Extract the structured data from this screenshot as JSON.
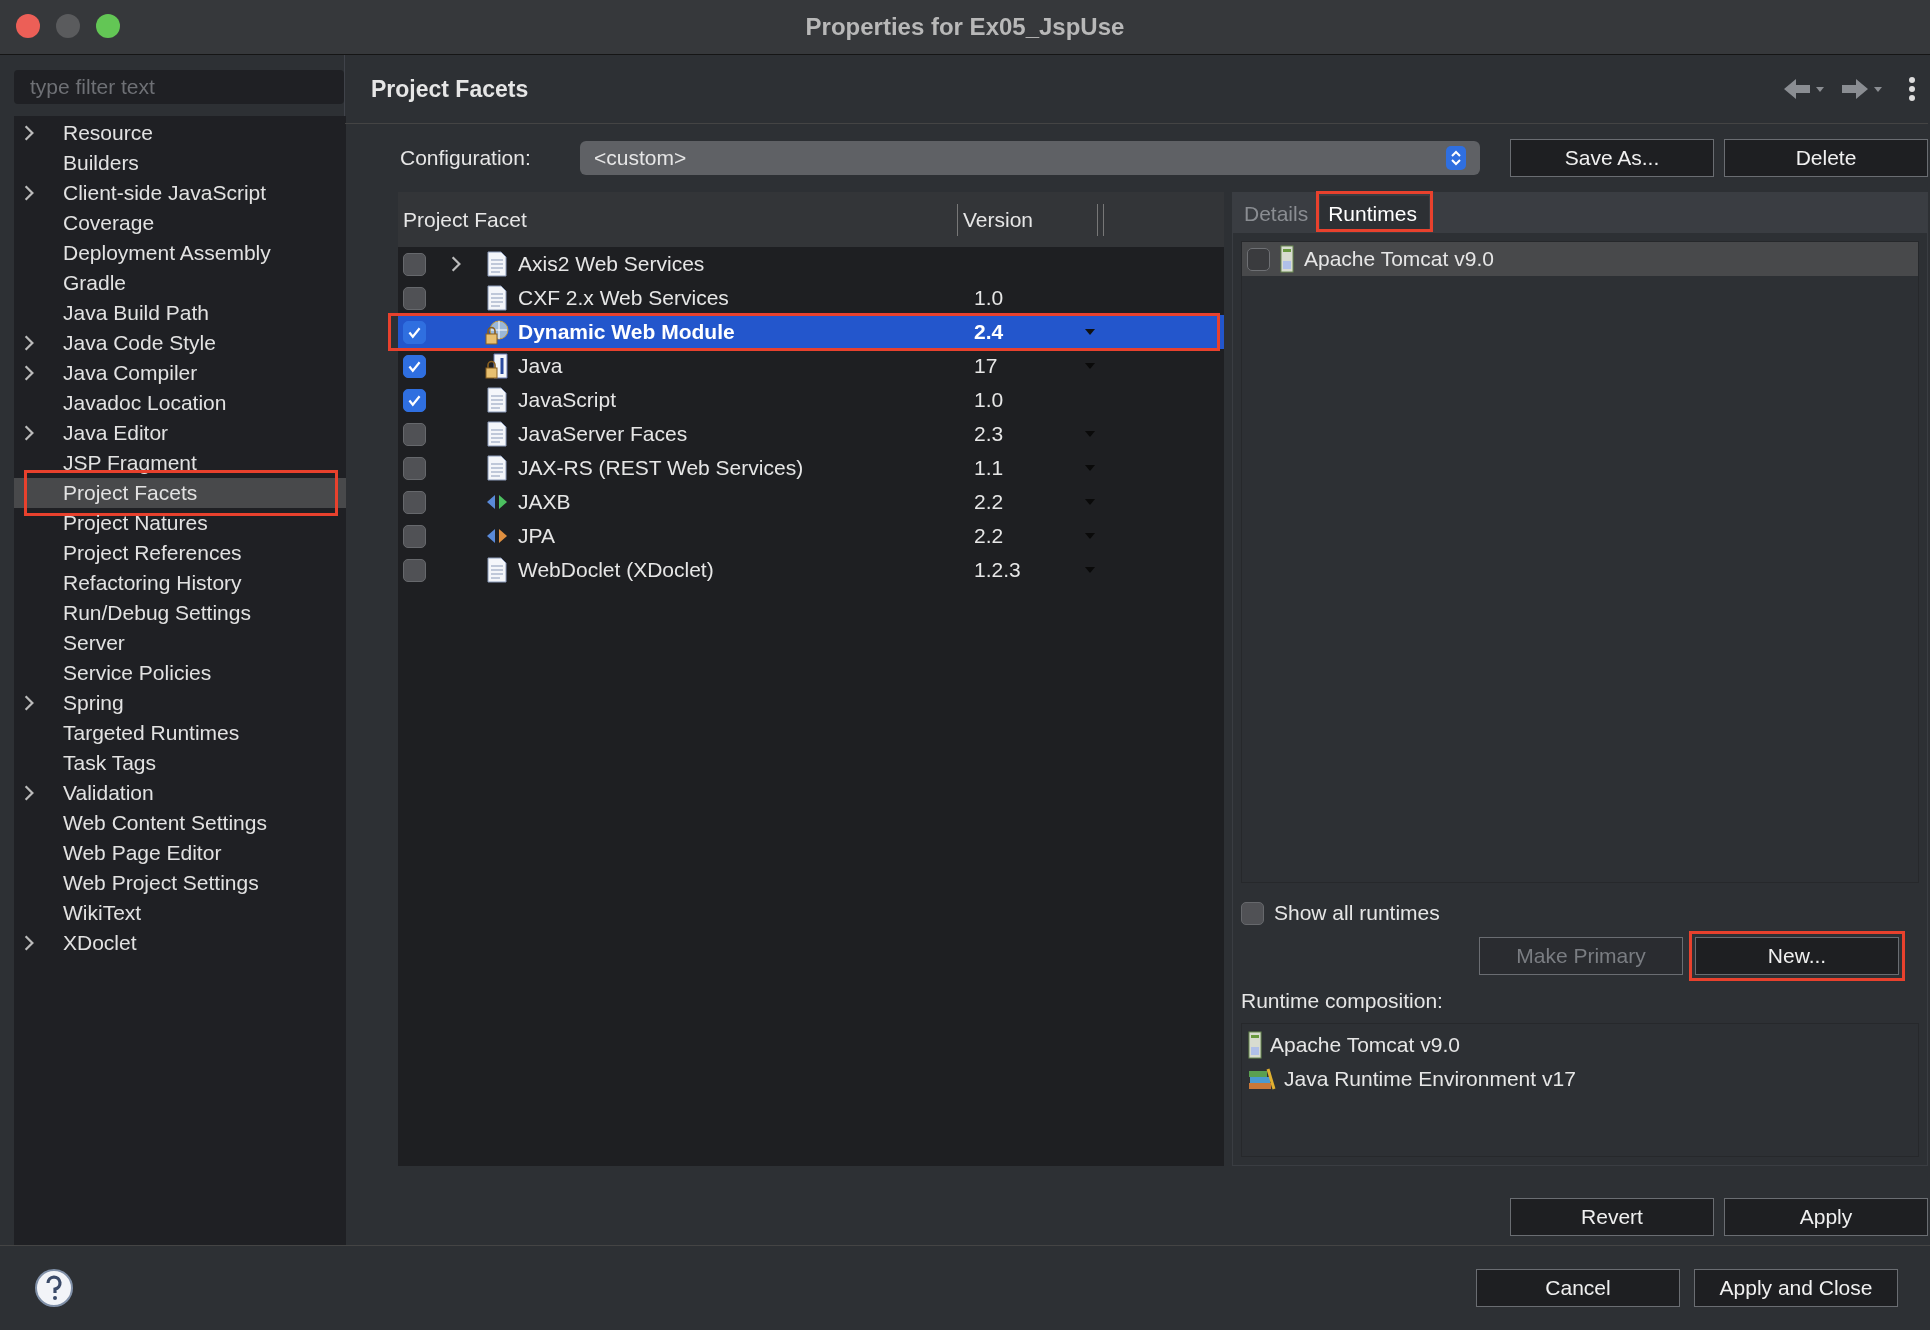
{
  "window": {
    "title": "Properties for Ex05_JspUse"
  },
  "filter": {
    "placeholder": "type filter text"
  },
  "sidebar": {
    "items": [
      {
        "label": "Resource",
        "expandable": true,
        "selected": false,
        "marked": false
      },
      {
        "label": "Builders",
        "expandable": false,
        "selected": false,
        "marked": false
      },
      {
        "label": "Client-side JavaScript",
        "expandable": true,
        "selected": false,
        "marked": false
      },
      {
        "label": "Coverage",
        "expandable": false,
        "selected": false,
        "marked": false
      },
      {
        "label": "Deployment Assembly",
        "expandable": false,
        "selected": false,
        "marked": false
      },
      {
        "label": "Gradle",
        "expandable": false,
        "selected": false,
        "marked": false
      },
      {
        "label": "Java Build Path",
        "expandable": false,
        "selected": false,
        "marked": false
      },
      {
        "label": "Java Code Style",
        "expandable": true,
        "selected": false,
        "marked": false
      },
      {
        "label": "Java Compiler",
        "expandable": true,
        "selected": false,
        "marked": false
      },
      {
        "label": "Javadoc Location",
        "expandable": false,
        "selected": false,
        "marked": false
      },
      {
        "label": "Java Editor",
        "expandable": true,
        "selected": false,
        "marked": false
      },
      {
        "label": "JSP Fragment",
        "expandable": false,
        "selected": false,
        "marked": false
      },
      {
        "label": "Project Facets",
        "expandable": false,
        "selected": true,
        "marked": true
      },
      {
        "label": "Project Natures",
        "expandable": false,
        "selected": false,
        "marked": false
      },
      {
        "label": "Project References",
        "expandable": false,
        "selected": false,
        "marked": false
      },
      {
        "label": "Refactoring History",
        "expandable": false,
        "selected": false,
        "marked": false
      },
      {
        "label": "Run/Debug Settings",
        "expandable": false,
        "selected": false,
        "marked": false
      },
      {
        "label": "Server",
        "expandable": false,
        "selected": false,
        "marked": false
      },
      {
        "label": "Service Policies",
        "expandable": false,
        "selected": false,
        "marked": false
      },
      {
        "label": "Spring",
        "expandable": true,
        "selected": false,
        "marked": false
      },
      {
        "label": "Targeted Runtimes",
        "expandable": false,
        "selected": false,
        "marked": false
      },
      {
        "label": "Task Tags",
        "expandable": false,
        "selected": false,
        "marked": false
      },
      {
        "label": "Validation",
        "expandable": true,
        "selected": false,
        "marked": false
      },
      {
        "label": "Web Content Settings",
        "expandable": false,
        "selected": false,
        "marked": false
      },
      {
        "label": "Web Page Editor",
        "expandable": false,
        "selected": false,
        "marked": false
      },
      {
        "label": "Web Project Settings",
        "expandable": false,
        "selected": false,
        "marked": false
      },
      {
        "label": "WikiText",
        "expandable": false,
        "selected": false,
        "marked": false
      },
      {
        "label": "XDoclet",
        "expandable": true,
        "selected": false,
        "marked": false
      }
    ]
  },
  "page": {
    "title": "Project Facets"
  },
  "configuration": {
    "label": "Configuration:",
    "value": "<custom>",
    "buttons": [
      "Save As...",
      "Delete"
    ]
  },
  "facets": {
    "columns": [
      "Project Facet",
      "Version"
    ],
    "rows": [
      {
        "name": "Axis2 Web Services",
        "version": "",
        "kind": "document",
        "checked": false,
        "selected": false,
        "expandable": true,
        "dropdown": false,
        "marked": false
      },
      {
        "name": "CXF 2.x Web Services",
        "version": "1.0",
        "kind": "document",
        "checked": false,
        "selected": false,
        "expandable": false,
        "dropdown": false,
        "marked": false
      },
      {
        "name": "Dynamic Web Module",
        "version": "2.4",
        "kind": "web-module",
        "checked": true,
        "selected": true,
        "expandable": false,
        "dropdown": true,
        "marked": true
      },
      {
        "name": "Java",
        "version": "17",
        "kind": "java",
        "checked": true,
        "selected": false,
        "expandable": false,
        "dropdown": true,
        "marked": false
      },
      {
        "name": "JavaScript",
        "version": "1.0",
        "kind": "document",
        "checked": true,
        "selected": false,
        "expandable": false,
        "dropdown": false,
        "marked": false
      },
      {
        "name": "JavaServer Faces",
        "version": "2.3",
        "kind": "document",
        "checked": false,
        "selected": false,
        "expandable": false,
        "dropdown": true,
        "marked": false
      },
      {
        "name": "JAX-RS (REST Web Services)",
        "version": "1.1",
        "kind": "document",
        "checked": false,
        "selected": false,
        "expandable": false,
        "dropdown": true,
        "marked": false
      },
      {
        "name": "JAXB",
        "version": "2.2",
        "kind": "jaxb",
        "checked": false,
        "selected": false,
        "expandable": false,
        "dropdown": true,
        "marked": false
      },
      {
        "name": "JPA",
        "version": "2.2",
        "kind": "jpa",
        "checked": false,
        "selected": false,
        "expandable": false,
        "dropdown": true,
        "marked": false
      },
      {
        "name": "WebDoclet (XDoclet)",
        "version": "1.2.3",
        "kind": "document",
        "checked": false,
        "selected": false,
        "expandable": false,
        "dropdown": true,
        "marked": false
      }
    ]
  },
  "side_tabs": [
    {
      "label": "Details",
      "selected": false,
      "marked": false
    },
    {
      "label": "Runtimes",
      "selected": true,
      "marked": true
    }
  ],
  "runtimes": [
    {
      "name": "Apache Tomcat v9.0",
      "checked": false
    }
  ],
  "show_all_runtimes": {
    "label": "Show all runtimes",
    "checked": false
  },
  "runtime_buttons": [
    {
      "label": "Make Primary",
      "disabled": true,
      "marked": false
    },
    {
      "label": "New...",
      "disabled": false,
      "marked": true
    }
  ],
  "composition": {
    "label": "Runtime composition:",
    "items": [
      {
        "name": "Apache Tomcat v9.0",
        "kind": "server"
      },
      {
        "name": "Java Runtime Environment v17",
        "kind": "jre"
      }
    ]
  },
  "page_buttons": [
    "Revert",
    "Apply"
  ],
  "dialog_buttons": [
    "Cancel",
    "Apply and Close"
  ]
}
